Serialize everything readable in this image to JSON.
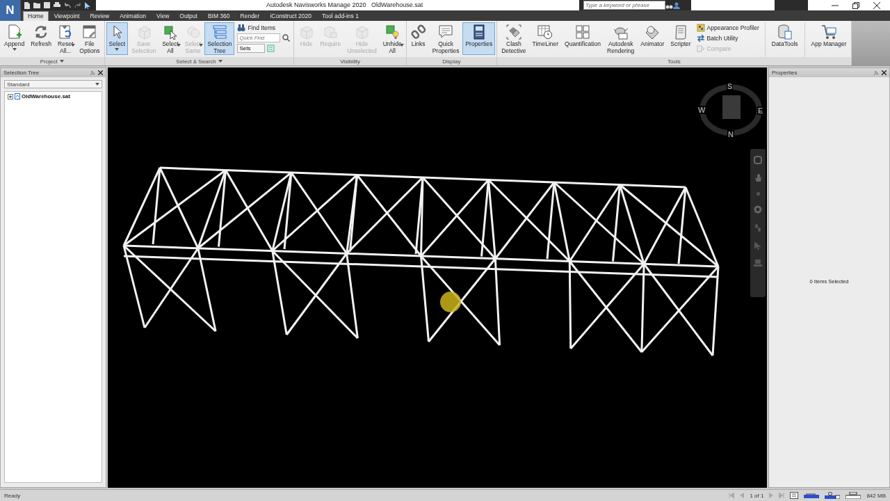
{
  "title_bar": {
    "app_letter": "N",
    "title": "Autodesk Navisworks Manage 2020   OldWarehouse.sat",
    "search": {
      "placeholder": "Type a keyword or phrase"
    }
  },
  "tabs": [
    {
      "label": "Home",
      "selected": true
    },
    {
      "label": "Viewpoint",
      "selected": false
    },
    {
      "label": "Review",
      "selected": false
    },
    {
      "label": "Animation",
      "selected": false
    },
    {
      "label": "View",
      "selected": false
    },
    {
      "label": "Output",
      "selected": false
    },
    {
      "label": "BIM 360",
      "selected": false
    },
    {
      "label": "Render",
      "selected": false
    },
    {
      "label": "iConstruct 2020",
      "selected": false
    },
    {
      "label": "Tool add-ins 1",
      "selected": false
    }
  ],
  "ribbon": {
    "panels": [
      {
        "title": "Project",
        "menu": true,
        "items": [
          {
            "kind": "large",
            "label": "Append",
            "dropdown": true,
            "active": false,
            "disabled": false
          },
          {
            "kind": "large",
            "label": "Refresh",
            "active": false,
            "disabled": false
          },
          {
            "kind": "large",
            "label": "Reset\nAll...",
            "dropdown": true,
            "active": false,
            "disabled": false
          },
          {
            "kind": "large",
            "label": "File\nOptions",
            "active": false,
            "disabled": false
          }
        ]
      },
      {
        "title": "Select & Search",
        "menu": true,
        "items": [
          {
            "kind": "large",
            "label": "Select",
            "dropdown": true,
            "active": true,
            "disabled": false
          },
          {
            "kind": "large",
            "label": "Save\nSelection",
            "active": false,
            "disabled": true
          },
          {
            "kind": "large",
            "label": "Select\nAll",
            "dropdown": true,
            "active": false,
            "disabled": false
          },
          {
            "kind": "large",
            "label": "Select\nSame",
            "dropdown": true,
            "active": false,
            "disabled": true
          },
          {
            "kind": "large",
            "label": "Selection\nTree",
            "active": true,
            "disabled": false
          },
          {
            "kind": "stack",
            "items": [
              {
                "kind": "button",
                "label": "Find Items",
                "disabled": false
              },
              {
                "kind": "search",
                "placeholder": "Quick Find"
              },
              {
                "kind": "combo",
                "label": "Sets"
              }
            ]
          }
        ]
      },
      {
        "title": "Visibility",
        "items": [
          {
            "kind": "large",
            "label": "Hide",
            "active": false,
            "disabled": true
          },
          {
            "kind": "large",
            "label": "Require",
            "active": false,
            "disabled": true
          },
          {
            "kind": "large",
            "label": "Hide\nUnselected",
            "active": false,
            "disabled": true
          },
          {
            "kind": "large",
            "label": "Unhide\nAll",
            "dropdown": true,
            "active": false,
            "disabled": false
          }
        ]
      },
      {
        "title": "Display",
        "items": [
          {
            "kind": "large",
            "label": "Links",
            "active": false,
            "disabled": false
          },
          {
            "kind": "large",
            "label": "Quick\nProperties",
            "active": false,
            "disabled": false
          },
          {
            "kind": "large",
            "label": "Properties",
            "active": true,
            "disabled": false
          }
        ]
      },
      {
        "title": "Tools",
        "items": [
          {
            "kind": "large",
            "label": "Clash\nDetective",
            "active": false,
            "disabled": false
          },
          {
            "kind": "large",
            "label": "TimeLiner",
            "active": false,
            "disabled": false
          },
          {
            "kind": "large",
            "label": "Quantification",
            "active": false,
            "disabled": false
          },
          {
            "kind": "large",
            "label": "Autodesk\nRendering",
            "active": false,
            "disabled": false
          },
          {
            "kind": "large",
            "label": "Animator",
            "active": false,
            "disabled": false
          },
          {
            "kind": "large",
            "label": "Scripter",
            "active": false,
            "disabled": false
          },
          {
            "kind": "stack",
            "items": [
              {
                "kind": "button",
                "label": "Appearance Profiler",
                "disabled": false
              },
              {
                "kind": "button",
                "label": "Batch Utility",
                "disabled": false
              },
              {
                "kind": "button",
                "label": "Compare",
                "disabled": true
              }
            ]
          },
          {
            "kind": "separator"
          },
          {
            "kind": "large",
            "label": "DataTools",
            "active": false,
            "disabled": false
          },
          {
            "kind": "separator"
          },
          {
            "kind": "large",
            "label": "App Manager",
            "active": false,
            "disabled": false
          }
        ]
      }
    ]
  },
  "left_panel": {
    "title": "Selection Tree",
    "dropdown": "Standard",
    "tree": [
      {
        "label": "OldWarehouse.sat",
        "expanded": false
      }
    ]
  },
  "viewport": {
    "viewcube": {
      "top": "S",
      "left": "W",
      "right": "E",
      "bottom": "N"
    }
  },
  "right_panel": {
    "title": "Properties",
    "message": "0 Items Selected"
  },
  "status_bar": {
    "text": "Ready",
    "page": "1 of 1",
    "memory": "842 MB"
  }
}
